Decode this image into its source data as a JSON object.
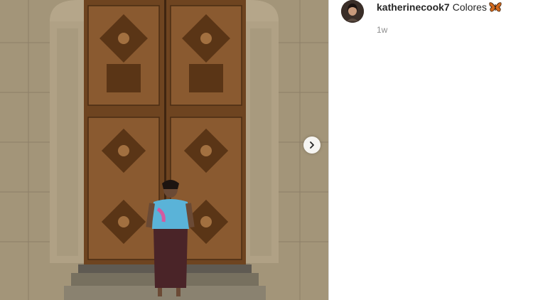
{
  "post": {
    "username": "katherinecook7",
    "caption": "Colores",
    "caption_emoji": "butterfly-icon",
    "timestamp": "1w"
  },
  "media": {
    "description_icon": "photo",
    "carousel_next_icon": "chevron-right-icon"
  },
  "colors": {
    "username": "#262626",
    "timestamp": "#8e8e8e",
    "divider": "#dbdbdb"
  }
}
